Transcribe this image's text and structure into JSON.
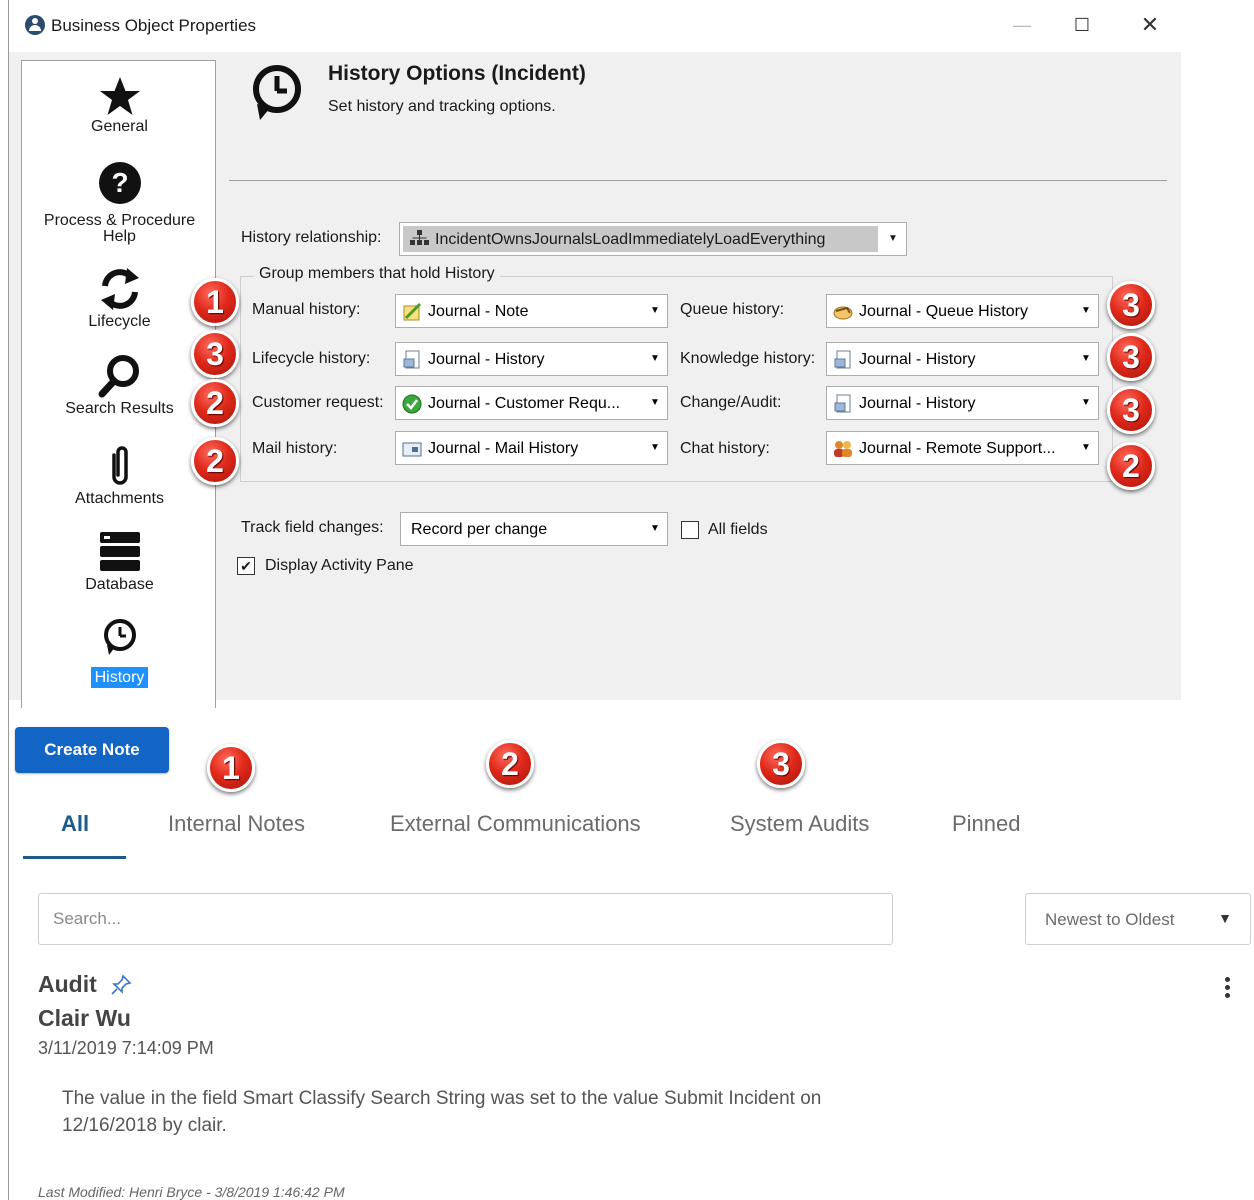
{
  "window": {
    "title": "Business Object Properties",
    "minimize": "—",
    "maximize": "☐",
    "close": "✕"
  },
  "sidebar": {
    "items": [
      {
        "label": "General",
        "icon": "star-icon"
      },
      {
        "label": "Process & Procedure",
        "label2": "Help",
        "icon": "question-icon"
      },
      {
        "label": "Lifecycle",
        "icon": "refresh-icon"
      },
      {
        "label": "Search Results",
        "icon": "magnifier-icon"
      },
      {
        "label": "Attachments",
        "icon": "paperclip-icon"
      },
      {
        "label": "Database",
        "icon": "database-icon"
      },
      {
        "label": "History",
        "icon": "history-icon",
        "selected": true
      }
    ]
  },
  "header": {
    "title": "History Options  (Incident)",
    "subtitle": "Set history and tracking options."
  },
  "form": {
    "history_relationship_label": "History relationship:",
    "history_relationship_value": "IncidentOwnsJournalsLoadImmediatelyLoadEverything",
    "group_legend": "Group members that hold History",
    "fields": {
      "manual": {
        "label": "Manual history:",
        "value": "Journal - Note"
      },
      "lifecycle": {
        "label": "Lifecycle history:",
        "value": "Journal - History"
      },
      "customer": {
        "label": "Customer request:",
        "value": "Journal  -  Customer  Requ..."
      },
      "mail": {
        "label": "Mail history:",
        "value": "Journal - Mail History"
      },
      "queue": {
        "label": "Queue history:",
        "value": "Journal - Queue History"
      },
      "knowledge": {
        "label": "Knowledge history:",
        "value": "Journal - History"
      },
      "change": {
        "label": "Change/Audit:",
        "value": "Journal - History"
      },
      "chat": {
        "label": "Chat history:",
        "value": "Journal  -  Remote  Support..."
      }
    },
    "track_label": "Track field changes:",
    "track_value": "Record per change",
    "all_fields_label": "All fields",
    "display_activity_label": "Display Activity Pane",
    "display_activity_checked": "✔"
  },
  "badges": {
    "manual": "1",
    "lifecycle": "3",
    "customer": "2",
    "mail": "2",
    "queue": "3",
    "knowledge": "3",
    "change": "3",
    "chat": "2",
    "tab_internal": "1",
    "tab_external": "2",
    "tab_system": "3"
  },
  "journal": {
    "create_note": "Create Note",
    "tabs": [
      "All",
      "Internal Notes",
      "External Communications",
      "System Audits",
      "Pinned"
    ],
    "search_placeholder": "Search...",
    "sort_value": "Newest to Oldest",
    "sort_arrow": "▼",
    "entry": {
      "type": "Audit",
      "user": "Clair Wu",
      "date": "3/11/2019 7:14:09 PM",
      "body": "The value in the field Smart Classify Search String was set to the value Submit Incident on 12/16/2018 by clair.",
      "last_modified": "Last Modified: Henri Bryce - 3/8/2019 1:46:42 PM"
    }
  },
  "colors": {
    "badge_red": "#e02a1b",
    "primary_blue": "#1265c4",
    "tab_active": "#1e5a8a",
    "history_selected": "#1e90ff"
  }
}
